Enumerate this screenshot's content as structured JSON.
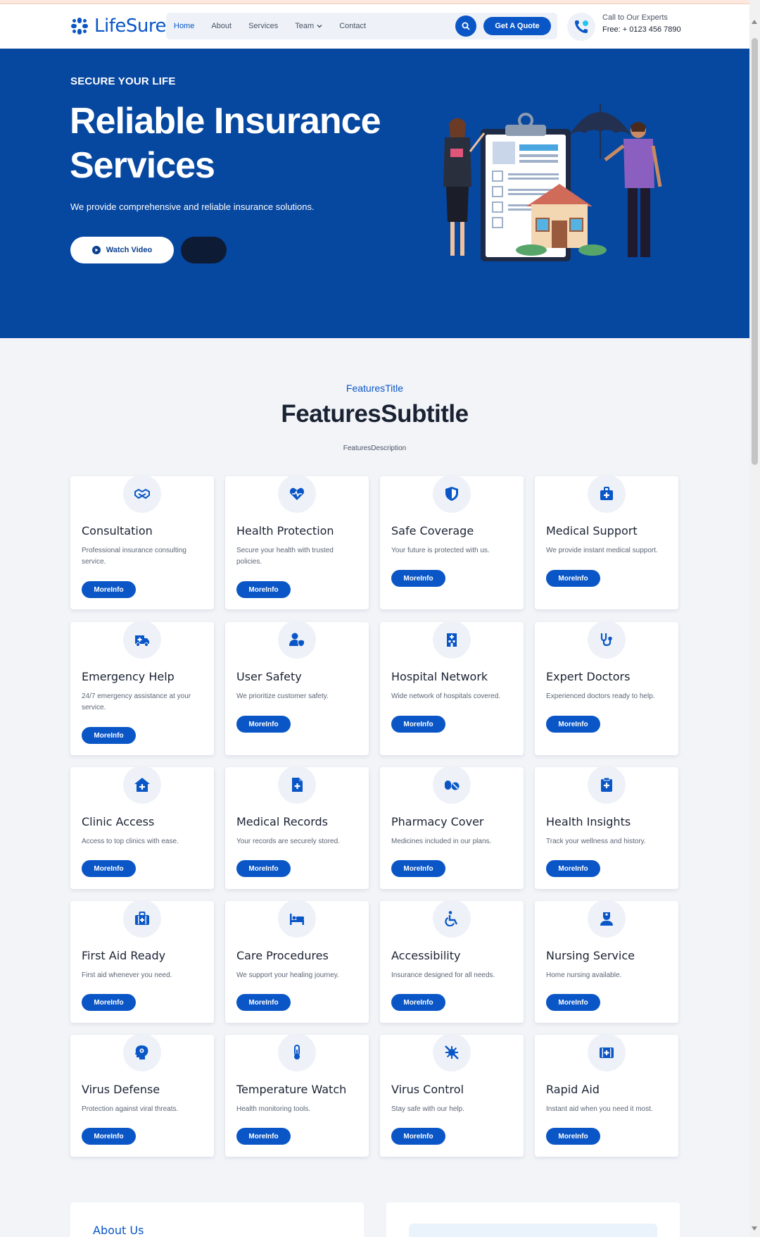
{
  "header": {
    "logo_text": "LifeSure",
    "nav": [
      {
        "label": "Home",
        "active": true
      },
      {
        "label": "About"
      },
      {
        "label": "Services"
      },
      {
        "label": "Team"
      },
      {
        "label": "Contact"
      }
    ],
    "quote_button": "Get A Quote",
    "call_label": "Call to Our Experts",
    "call_phone": "Free: + 0123 456 7890"
  },
  "hero": {
    "kicker": "SECURE YOUR LIFE",
    "title": "Reliable Insurance Services",
    "description": "We provide comprehensive and reliable insurance solutions.",
    "watch_button": "Watch Video"
  },
  "features": {
    "title": "FeaturesTitle",
    "subtitle": "FeaturesSubtitle",
    "description": "FeaturesDescription",
    "button_label": "MoreInfo",
    "cards": [
      {
        "icon": "handshake-icon",
        "title": "Consultation",
        "text": "Professional insurance consulting service."
      },
      {
        "icon": "heart-pulse-icon",
        "title": "Health Protection",
        "text": "Secure your health with trusted policies."
      },
      {
        "icon": "shield-icon",
        "title": "Safe Coverage",
        "text": "Your future is protected with us."
      },
      {
        "icon": "medkit-icon",
        "title": "Medical Support",
        "text": "We provide instant medical support."
      },
      {
        "icon": "ambulance-icon",
        "title": "Emergency Help",
        "text": "24/7 emergency assistance at your service."
      },
      {
        "icon": "user-shield-icon",
        "title": "User Safety",
        "text": "We prioritize customer safety."
      },
      {
        "icon": "hospital-icon",
        "title": "Hospital Network",
        "text": "Wide network of hospitals covered."
      },
      {
        "icon": "stethoscope-icon",
        "title": "Expert Doctors",
        "text": "Experienced doctors ready to help."
      },
      {
        "icon": "clinic-house-icon",
        "title": "Clinic Access",
        "text": "Access to top clinics with ease."
      },
      {
        "icon": "medical-file-icon",
        "title": "Medical Records",
        "text": "Your records are securely stored."
      },
      {
        "icon": "pills-icon",
        "title": "Pharmacy Cover",
        "text": "Medicines included in our plans."
      },
      {
        "icon": "clipboard-medical-icon",
        "title": "Health Insights",
        "text": "Track your wellness and history."
      },
      {
        "icon": "first-aid-kit-icon",
        "title": "First Aid Ready",
        "text": "First aid whenever you need."
      },
      {
        "icon": "hospital-bed-icon",
        "title": "Care Procedures",
        "text": "We support your healing journey."
      },
      {
        "icon": "wheelchair-icon",
        "title": "Accessibility",
        "text": "Insurance designed for all needs."
      },
      {
        "icon": "nurse-icon",
        "title": "Nursing Service",
        "text": "Home nursing available."
      },
      {
        "icon": "virus-head-icon",
        "title": "Virus Defense",
        "text": "Protection against viral threats."
      },
      {
        "icon": "thermometer-icon",
        "title": "Temperature Watch",
        "text": "Health monitoring tools."
      },
      {
        "icon": "virus-slash-icon",
        "title": "Virus Control",
        "text": "Stay safe with our help."
      },
      {
        "icon": "first-aid-box-icon",
        "title": "Rapid Aid",
        "text": "Instant aid when you need it most."
      }
    ]
  },
  "about": {
    "title": "About Us"
  },
  "colors": {
    "brand": "#0a56c7",
    "hero_bg": "#0647a0",
    "dark_button": "#0d1b35",
    "page_bg": "#f2f4f8"
  }
}
